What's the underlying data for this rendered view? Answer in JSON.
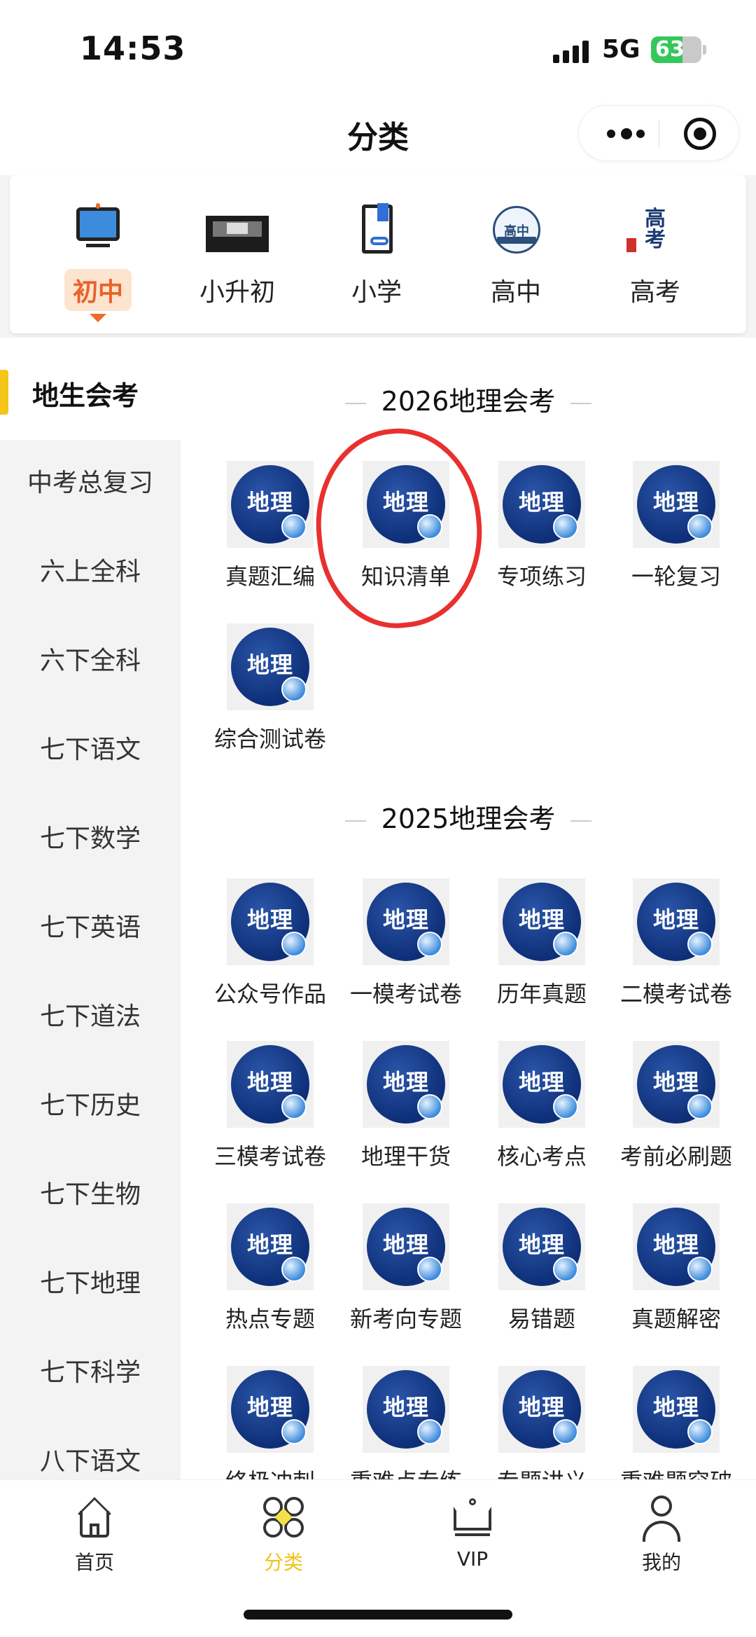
{
  "status_bar": {
    "time": "14:53",
    "network": "5G",
    "battery": "63",
    "battery_level": 0.63
  },
  "nav": {
    "title": "分类"
  },
  "categories": [
    {
      "label": "初中",
      "icon": "monitor-icon",
      "active": true
    },
    {
      "label": "小升初",
      "icon": "banner-image-icon",
      "active": false
    },
    {
      "label": "小学",
      "icon": "book-bookmark-icon",
      "active": false
    },
    {
      "label": "高中",
      "icon": "high-school-badge-icon",
      "icon_text": "高中",
      "active": false
    },
    {
      "label": "高考",
      "icon": "gaokao-logo-icon",
      "icon_text": "高考",
      "active": false
    }
  ],
  "sidebar": {
    "active": "地生会考",
    "items": [
      "中考总复习",
      "六上全科",
      "六下全科",
      "七下语文",
      "七下数学",
      "七下英语",
      "七下道法",
      "七下历史",
      "七下生物",
      "七下地理",
      "七下科学",
      "八下语文"
    ]
  },
  "thumb_text": "地理",
  "sections": [
    {
      "title": "2026地理会考",
      "items": [
        "真题汇编",
        "知识清单",
        "专项练习",
        "一轮复习",
        "综合测试卷"
      ]
    },
    {
      "title": "2025地理会考",
      "items": [
        "公众号作品",
        "一模考试卷",
        "历年真题",
        "二模考试卷",
        "三模考试卷",
        "地理干货",
        "核心考点",
        "考前必刷题",
        "热点专题",
        "新考向专题",
        "易错题",
        "真题解密",
        "终极冲刺",
        "重难点专练",
        "专题讲义",
        "重难题突破"
      ]
    }
  ],
  "tabbar": [
    {
      "label": "首页",
      "icon": "home-icon",
      "active": false
    },
    {
      "label": "分类",
      "icon": "category-icon",
      "active": true
    },
    {
      "label": "VIP",
      "icon": "crown-icon",
      "active": false
    },
    {
      "label": "我的",
      "icon": "user-icon",
      "active": false
    }
  ],
  "colors": {
    "accent_yellow": "#f5c518",
    "active_orange": "#e9622a",
    "thumb_blue": "#0e2f78",
    "annotation_red": "#e8312f"
  }
}
